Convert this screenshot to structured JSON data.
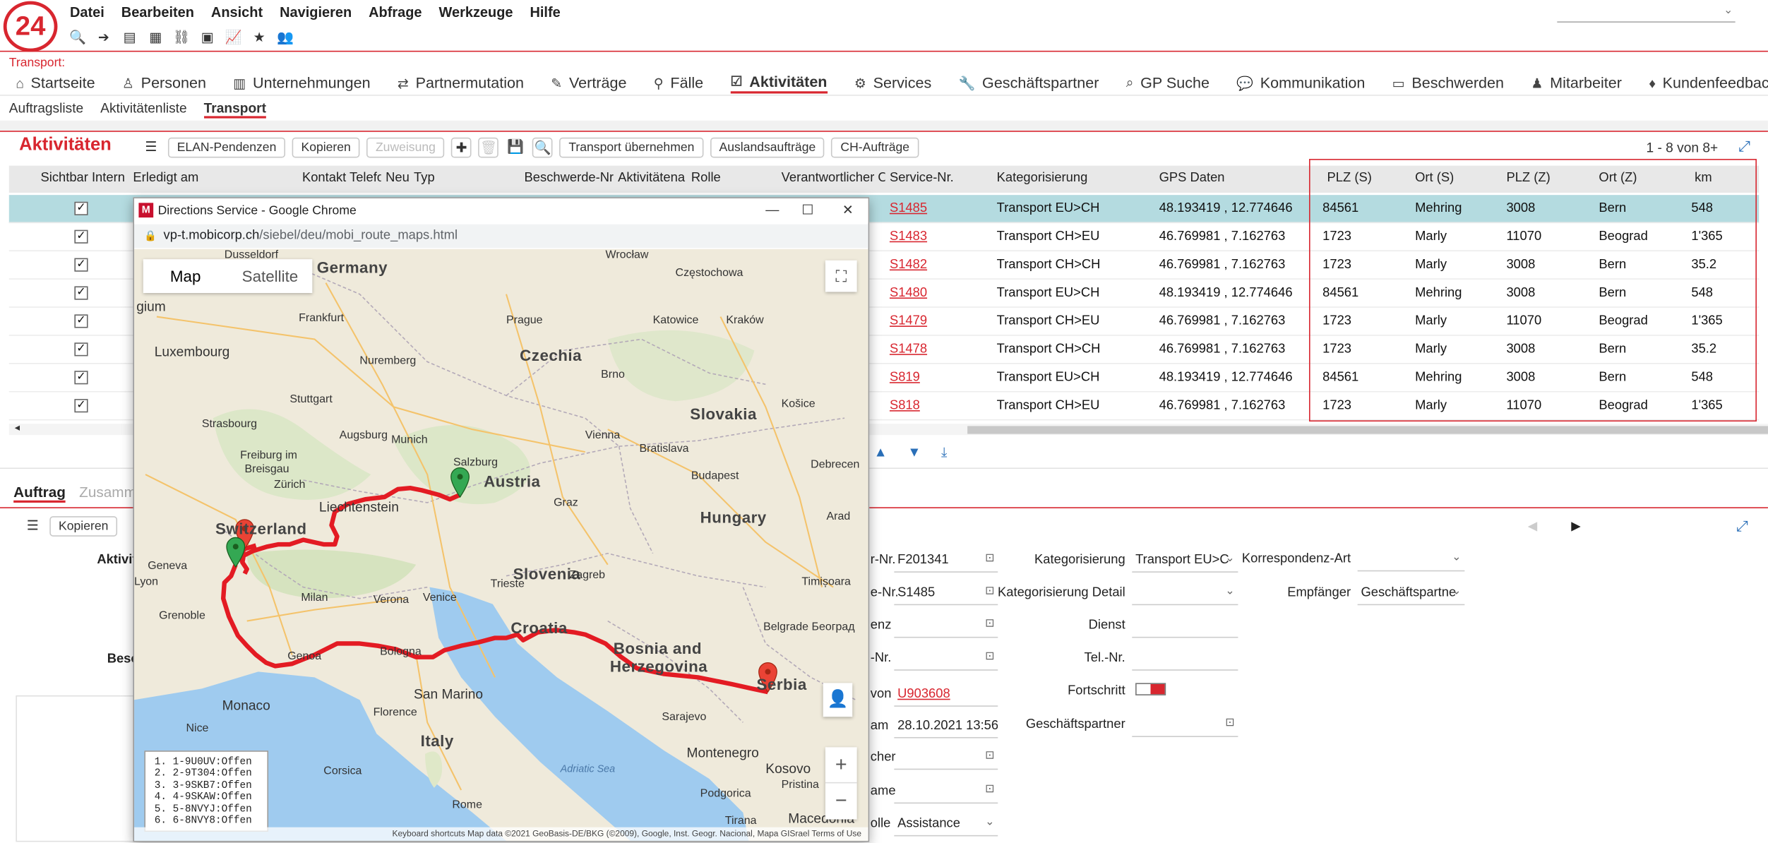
{
  "app": {
    "logo_text": "24",
    "menu": [
      "Datei",
      "Bearbeiten",
      "Ansicht",
      "Navigieren",
      "Abfrage",
      "Werkzeuge",
      "Hilfe"
    ],
    "breadcrumb": "Transport:",
    "nav_tabs": [
      {
        "label": "Startseite",
        "icon": "home-icon"
      },
      {
        "label": "Personen",
        "icon": "person-icon"
      },
      {
        "label": "Unternehmungen",
        "icon": "building-icon"
      },
      {
        "label": "Partnermutation",
        "icon": "mutation-icon"
      },
      {
        "label": "Verträge",
        "icon": "contract-icon"
      },
      {
        "label": "Fälle",
        "icon": "pin-icon"
      },
      {
        "label": "Aktivitäten",
        "icon": "checklist-icon",
        "active": true
      },
      {
        "label": "Services",
        "icon": "services-icon"
      },
      {
        "label": "Geschäftspartner",
        "icon": "wrench-icon"
      },
      {
        "label": "GP Suche",
        "icon": "binoculars-icon"
      },
      {
        "label": "Kommunikation",
        "icon": "chat-icon"
      },
      {
        "label": "Beschwerden",
        "icon": "complaint-icon"
      },
      {
        "label": "Mitarbeiter",
        "icon": "employee-icon"
      },
      {
        "label": "Kundenfeedback",
        "icon": "feedback-icon"
      }
    ],
    "sub_nav": [
      "Auftragsliste",
      "Aktivitätenliste",
      "Transport"
    ],
    "sub_nav_active": "Transport"
  },
  "list": {
    "title": "Aktivitäten",
    "buttons": {
      "elan": "ELAN-Pendenzen",
      "kopieren": "Kopieren",
      "zuweisung": "Zuweisung",
      "transport": "Transport übernehmen",
      "ausland": "Auslandsaufträge",
      "ch": "CH-Aufträge"
    },
    "record_count": "1 - 8 von 8+",
    "columns": [
      "Sichtbar Intern",
      "Erledigt am",
      "Kontakt Telefo",
      "Neu",
      "Typ",
      "Beschwerde-Nr.",
      "Aktivitätena",
      "Rolle",
      "Verantwortlicher Or",
      "Service-Nr.",
      "Kategorisierung",
      "GPS Daten",
      "PLZ (S)",
      "Ort (S)",
      "PLZ (Z)",
      "Ort (Z)",
      "km"
    ],
    "rows": [
      {
        "service": "S1485",
        "kat": "Transport EU>CH",
        "gps": "48.193419 , 12.774646",
        "plz_s": "84561",
        "ort_s": "Mehring",
        "plz_z": "3008",
        "ort_z": "Bern",
        "km": "548"
      },
      {
        "service": "S1483",
        "kat": "Transport CH>EU",
        "gps": "46.769981 , 7.162763",
        "plz_s": "1723",
        "ort_s": "Marly",
        "plz_z": "11070",
        "ort_z": "Beograd",
        "km": "1'365"
      },
      {
        "service": "S1482",
        "kat": "Transport CH>CH",
        "gps": "46.769981 , 7.162763",
        "plz_s": "1723",
        "ort_s": "Marly",
        "plz_z": "3008",
        "ort_z": "Bern",
        "km": "35.2"
      },
      {
        "service": "S1480",
        "kat": "Transport EU>CH",
        "gps": "48.193419 , 12.774646",
        "plz_s": "84561",
        "ort_s": "Mehring",
        "plz_z": "3008",
        "ort_z": "Bern",
        "km": "548"
      },
      {
        "service": "S1479",
        "kat": "Transport CH>EU",
        "gps": "46.769981 , 7.162763",
        "plz_s": "1723",
        "ort_s": "Marly",
        "plz_z": "11070",
        "ort_z": "Beograd",
        "km": "1'365"
      },
      {
        "service": "S1478",
        "kat": "Transport CH>CH",
        "gps": "46.769981 , 7.162763",
        "plz_s": "1723",
        "ort_s": "Marly",
        "plz_z": "3008",
        "ort_z": "Bern",
        "km": "35.2"
      },
      {
        "service": "S819",
        "kat": "Transport EU>CH",
        "gps": "48.193419 , 12.774646",
        "plz_s": "84561",
        "ort_s": "Mehring",
        "plz_z": "3008",
        "ort_z": "Bern",
        "km": "548"
      },
      {
        "service": "S818",
        "kat": "Transport CH>EU",
        "gps": "46.769981 , 7.162763",
        "plz_s": "1723",
        "ort_s": "Marly",
        "plz_z": "11070",
        "ort_z": "Beograd",
        "km": "1'365"
      }
    ]
  },
  "detail": {
    "tabs": [
      "Auftrag",
      "Zusamm"
    ],
    "kopieren": "Kopieren",
    "left_labels": [
      "Aktivit",
      "Besch"
    ],
    "fields_mid_labels": [
      "r-Nr.",
      "e-Nr.",
      "enz",
      "-Nr.",
      "von",
      "am",
      "cher",
      "ame",
      "olle"
    ],
    "fields_mid": [
      "F201341",
      "S1485",
      "",
      "",
      "U903608",
      "28.10.2021  13:56",
      "",
      "",
      "Assistance"
    ],
    "kat_label": "Kategorisierung",
    "kat_value": "Transport EU>C",
    "kat_detail_label": "Kategorisierung Detail",
    "dienst_label": "Dienst",
    "tel_label": "Tel.-Nr.",
    "fortschritt_label": "Fortschritt",
    "fortschritt_value": 0.5,
    "gp_label": "Geschäftspartner",
    "korr_label": "Korrespondenz-Art",
    "empf_label": "Empfänger",
    "empf_value": "Geschäftspartne"
  },
  "popup": {
    "window_title": "Directions Service - Google Chrome",
    "url_host": "vp-t.mobicorp.ch",
    "url_path": "/siebel/deu/mobi_route_maps.html",
    "map_btn": "Map",
    "satellite_btn": "Satellite",
    "waypoints": [
      "1-9U0UV:Offen",
      "2-9T304:Offen",
      "3-9SKB7:Offen",
      "4-9SKAW:Offen",
      "5-8NVYJ:Offen",
      "6-8NVY8:Offen"
    ],
    "attribution": "Keyboard shortcuts    Map data ©2021 GeoBasis-DE/BKG (©2009), Google, Inst. Geogr. Nacional, Mapa GISrael    Terms of Use",
    "place_labels": {
      "countries": [
        "Germany",
        "Czechia",
        "Slovakia",
        "Austria",
        "Hungary",
        "Switzerland",
        "Slovenia",
        "Croatia",
        "Bosnia and",
        "Herzegovina",
        "Serbia",
        "Italy",
        "Liechtenstein",
        "Montenegro",
        "Kosovo",
        "Macedonia",
        "San Marino",
        "Monaco",
        "Luxembourg",
        "gium"
      ],
      "cities": [
        "Frankfurt",
        "Prague",
        "Wrocław",
        "Częstochowa",
        "Katowice",
        "Kraków",
        "Nuremberg",
        "Brno",
        "Košice",
        "Stuttgart",
        "Strasbourg",
        "Augsburg",
        "Munich",
        "Vienna",
        "Bratislava",
        "Salzburg",
        "Freiburg im",
        "Breisgau",
        "Zürich",
        "Budapest",
        "Graz",
        "Geneva",
        "Milan",
        "Verona",
        "Venice",
        "Trieste",
        "Zagreb",
        "Timișoara",
        "Grenoble",
        "Genoa",
        "Bologna",
        "Florence",
        "Sarajevo",
        "Rome",
        "Belgrade Београд",
        "Tirana",
        "Nice",
        "Lyon",
        "Dusseldorf",
        "Debrecen",
        "Arad",
        "Podgorica",
        "Pristina",
        "Adriatic Sea",
        "Corsica"
      ]
    }
  },
  "colors": {
    "accent": "#d8262f",
    "selected_row": "#b4dbe0",
    "route": "#e31b23"
  }
}
